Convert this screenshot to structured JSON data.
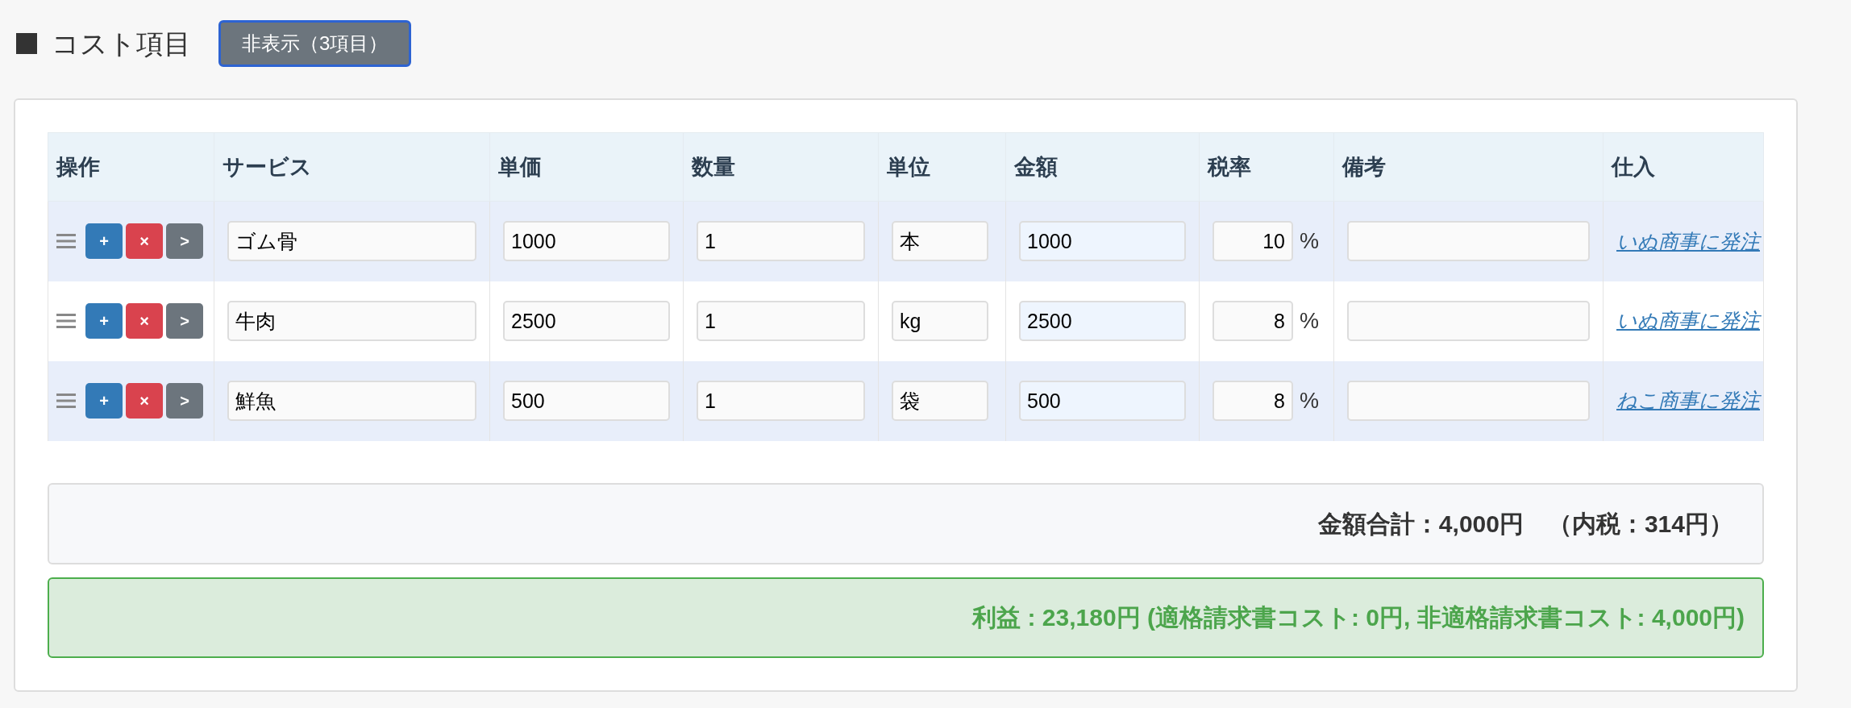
{
  "section": {
    "title": "コスト項目",
    "toggle_button": "非表示（3項目）"
  },
  "table": {
    "columns": [
      "操作",
      "サービス",
      "単価",
      "数量",
      "単位",
      "金額",
      "税率",
      "備考",
      "仕入"
    ],
    "row_buttons": [
      "+",
      "×",
      ">"
    ],
    "rows": [
      {
        "service": "ゴム骨",
        "unit_price": "1000",
        "quantity": "1",
        "unit": "本",
        "amount": "1000",
        "tax_rate": "10",
        "tax_suffix": "%",
        "order_link": "いぬ商事に発注"
      },
      {
        "service": "牛肉",
        "unit_price": "2500",
        "quantity": "1",
        "unit": "kg",
        "amount": "2500",
        "tax_rate": "8",
        "tax_suffix": "%",
        "order_link": "いぬ商事に発注"
      },
      {
        "service": "鮮魚",
        "unit_price": "500",
        "quantity": "1",
        "unit": "袋",
        "amount": "500",
        "tax_rate": "8",
        "tax_suffix": "%",
        "order_link": "ねこ商事に発注"
      }
    ]
  },
  "total": "金額合計：4,000円　（内税：314円）",
  "profit": "利益 : 23,180円 (適格請求書コスト: 0円, 非適格請求書コスト: 4,000円)"
}
